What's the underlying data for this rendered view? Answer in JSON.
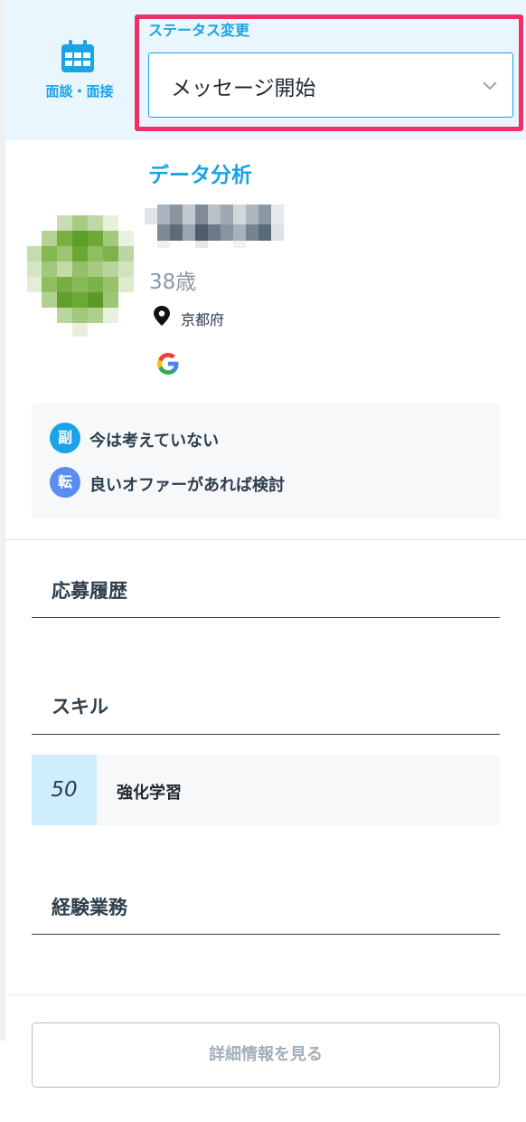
{
  "header": {
    "interview_label": "面談・面接",
    "status_label": "ステータス変更",
    "status_value": "メッセージ開始"
  },
  "profile": {
    "job_title": "データ分析",
    "age": "38歳",
    "location": "京都府",
    "intents": [
      {
        "badge": "副",
        "text": "今は考えていない",
        "color": "#1aa3e6"
      },
      {
        "badge": "転",
        "text": "良いオファーがあれば検討",
        "color": "#5a8cf2"
      }
    ]
  },
  "sections": {
    "applications_title": "応募履歴",
    "skills_title": "スキル",
    "skills": [
      {
        "score": "50",
        "name": "強化学習"
      }
    ],
    "experience_title": "経験業務"
  },
  "footer": {
    "detail_button": "詳細情報を見る"
  },
  "icons": {
    "interview": "calendar-icon",
    "status": "chevron-down-icon",
    "location": "map-pin-icon",
    "account": "google-icon"
  },
  "colors": {
    "accent": "#1aa3e6",
    "highlight_frame": "#ef2f6a",
    "header_bg": "#eaf6fd",
    "skill_score_bg": "#cfeefd",
    "text": "#2f3e4c"
  }
}
